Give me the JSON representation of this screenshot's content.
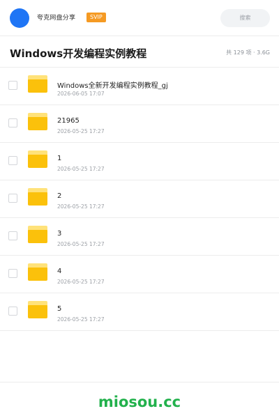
{
  "header": {
    "app_name": "夸克网盘分享",
    "badge": "SVIP",
    "search_label": "搜索",
    "avatar_color": "#1f75f5",
    "badge_color": "#f59a23"
  },
  "title_bar": {
    "title": "Windows开发编程实例教程",
    "meta": "共 129 项 · 3.6G"
  },
  "files": [
    {
      "name": "Windows全新开发编程实例教程_gj",
      "date": "2026-06-05 17:07",
      "icon": "folder-icon"
    },
    {
      "name": "21965",
      "date": "2026-05-25 17:27",
      "icon": "folder-icon"
    },
    {
      "name": "1",
      "date": "2026-05-25 17:27",
      "icon": "folder-icon"
    },
    {
      "name": "2",
      "date": "2026-05-25 17:27",
      "icon": "folder-icon"
    },
    {
      "name": "3",
      "date": "2026-05-25 17:27",
      "icon": "folder-icon"
    },
    {
      "name": "4",
      "date": "2026-05-25 17:27",
      "icon": "folder-icon"
    },
    {
      "name": "5",
      "date": "2026-05-25 17:27",
      "icon": "folder-icon"
    }
  ],
  "footer": {
    "brand": "miosou.cc",
    "brand_color": "#22b14c"
  }
}
